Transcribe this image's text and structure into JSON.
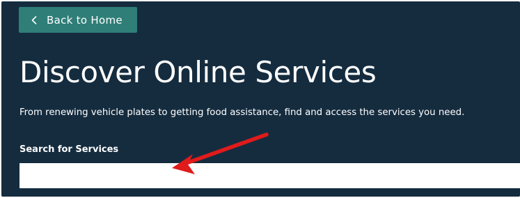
{
  "back_button": {
    "label": "Back to Home",
    "icon": "chevron-left-icon"
  },
  "header": {
    "title": "Discover Online Services",
    "lede": "From renewing vehicle plates to getting food assistance, find and access the services you need."
  },
  "search": {
    "label": "Search for Services",
    "value": "",
    "placeholder": ""
  },
  "colors": {
    "background": "#152c3f",
    "button": "#2f7e78",
    "annotation_arrow": "#e01b1b"
  }
}
